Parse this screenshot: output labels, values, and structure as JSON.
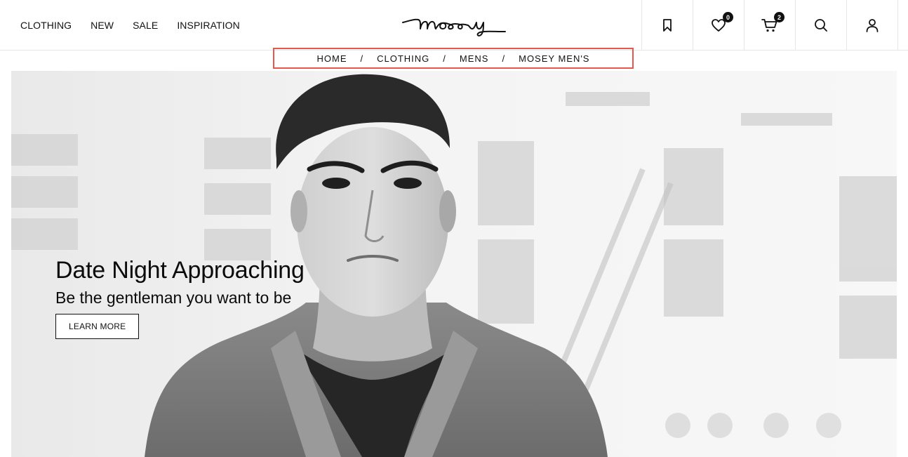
{
  "nav": {
    "items": [
      {
        "label": "CLOTHING"
      },
      {
        "label": "NEW"
      },
      {
        "label": "SALE"
      },
      {
        "label": "INSPIRATION"
      }
    ]
  },
  "logo": {
    "text": "mosey"
  },
  "header_icons": [
    {
      "icon": "bookmark-icon"
    },
    {
      "icon": "heart-icon",
      "badge": "0"
    },
    {
      "icon": "cart-icon",
      "badge": "2"
    },
    {
      "icon": "search-icon"
    },
    {
      "icon": "user-icon"
    }
  ],
  "breadcrumb": {
    "items": [
      {
        "label": "HOME"
      },
      {
        "label": "CLOTHING"
      },
      {
        "label": "MENS"
      },
      {
        "label": "MOSEY MEN'S"
      }
    ],
    "separator": "/",
    "highlight_color": "#e8574b"
  },
  "hero": {
    "title": "Date Night Approaching",
    "subtitle": "Be the gentleman you want to be",
    "button_label": "LEARN MORE"
  }
}
